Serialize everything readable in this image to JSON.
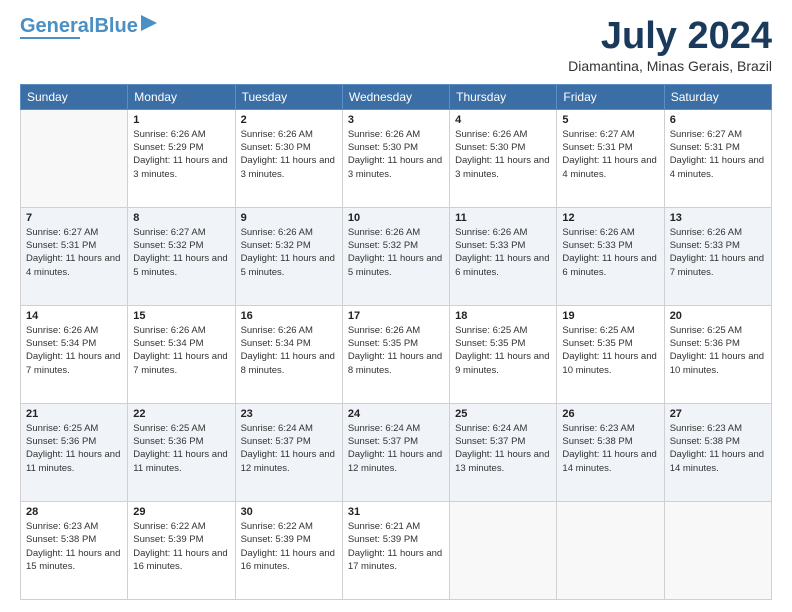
{
  "logo": {
    "part1": "General",
    "part2": "Blue"
  },
  "header": {
    "month": "July 2024",
    "location": "Diamantina, Minas Gerais, Brazil"
  },
  "weekdays": [
    "Sunday",
    "Monday",
    "Tuesday",
    "Wednesday",
    "Thursday",
    "Friday",
    "Saturday"
  ],
  "weeks": [
    [
      {
        "day": "",
        "empty": true
      },
      {
        "day": "1",
        "sunrise": "Sunrise: 6:26 AM",
        "sunset": "Sunset: 5:29 PM",
        "daylight": "Daylight: 11 hours and 3 minutes."
      },
      {
        "day": "2",
        "sunrise": "Sunrise: 6:26 AM",
        "sunset": "Sunset: 5:30 PM",
        "daylight": "Daylight: 11 hours and 3 minutes."
      },
      {
        "day": "3",
        "sunrise": "Sunrise: 6:26 AM",
        "sunset": "Sunset: 5:30 PM",
        "daylight": "Daylight: 11 hours and 3 minutes."
      },
      {
        "day": "4",
        "sunrise": "Sunrise: 6:26 AM",
        "sunset": "Sunset: 5:30 PM",
        "daylight": "Daylight: 11 hours and 3 minutes."
      },
      {
        "day": "5",
        "sunrise": "Sunrise: 6:27 AM",
        "sunset": "Sunset: 5:31 PM",
        "daylight": "Daylight: 11 hours and 4 minutes."
      },
      {
        "day": "6",
        "sunrise": "Sunrise: 6:27 AM",
        "sunset": "Sunset: 5:31 PM",
        "daylight": "Daylight: 11 hours and 4 minutes."
      }
    ],
    [
      {
        "day": "7",
        "sunrise": "Sunrise: 6:27 AM",
        "sunset": "Sunset: 5:31 PM",
        "daylight": "Daylight: 11 hours and 4 minutes."
      },
      {
        "day": "8",
        "sunrise": "Sunrise: 6:27 AM",
        "sunset": "Sunset: 5:32 PM",
        "daylight": "Daylight: 11 hours and 5 minutes."
      },
      {
        "day": "9",
        "sunrise": "Sunrise: 6:26 AM",
        "sunset": "Sunset: 5:32 PM",
        "daylight": "Daylight: 11 hours and 5 minutes."
      },
      {
        "day": "10",
        "sunrise": "Sunrise: 6:26 AM",
        "sunset": "Sunset: 5:32 PM",
        "daylight": "Daylight: 11 hours and 5 minutes."
      },
      {
        "day": "11",
        "sunrise": "Sunrise: 6:26 AM",
        "sunset": "Sunset: 5:33 PM",
        "daylight": "Daylight: 11 hours and 6 minutes."
      },
      {
        "day": "12",
        "sunrise": "Sunrise: 6:26 AM",
        "sunset": "Sunset: 5:33 PM",
        "daylight": "Daylight: 11 hours and 6 minutes."
      },
      {
        "day": "13",
        "sunrise": "Sunrise: 6:26 AM",
        "sunset": "Sunset: 5:33 PM",
        "daylight": "Daylight: 11 hours and 7 minutes."
      }
    ],
    [
      {
        "day": "14",
        "sunrise": "Sunrise: 6:26 AM",
        "sunset": "Sunset: 5:34 PM",
        "daylight": "Daylight: 11 hours and 7 minutes."
      },
      {
        "day": "15",
        "sunrise": "Sunrise: 6:26 AM",
        "sunset": "Sunset: 5:34 PM",
        "daylight": "Daylight: 11 hours and 7 minutes."
      },
      {
        "day": "16",
        "sunrise": "Sunrise: 6:26 AM",
        "sunset": "Sunset: 5:34 PM",
        "daylight": "Daylight: 11 hours and 8 minutes."
      },
      {
        "day": "17",
        "sunrise": "Sunrise: 6:26 AM",
        "sunset": "Sunset: 5:35 PM",
        "daylight": "Daylight: 11 hours and 8 minutes."
      },
      {
        "day": "18",
        "sunrise": "Sunrise: 6:25 AM",
        "sunset": "Sunset: 5:35 PM",
        "daylight": "Daylight: 11 hours and 9 minutes."
      },
      {
        "day": "19",
        "sunrise": "Sunrise: 6:25 AM",
        "sunset": "Sunset: 5:35 PM",
        "daylight": "Daylight: 11 hours and 10 minutes."
      },
      {
        "day": "20",
        "sunrise": "Sunrise: 6:25 AM",
        "sunset": "Sunset: 5:36 PM",
        "daylight": "Daylight: 11 hours and 10 minutes."
      }
    ],
    [
      {
        "day": "21",
        "sunrise": "Sunrise: 6:25 AM",
        "sunset": "Sunset: 5:36 PM",
        "daylight": "Daylight: 11 hours and 11 minutes."
      },
      {
        "day": "22",
        "sunrise": "Sunrise: 6:25 AM",
        "sunset": "Sunset: 5:36 PM",
        "daylight": "Daylight: 11 hours and 11 minutes."
      },
      {
        "day": "23",
        "sunrise": "Sunrise: 6:24 AM",
        "sunset": "Sunset: 5:37 PM",
        "daylight": "Daylight: 11 hours and 12 minutes."
      },
      {
        "day": "24",
        "sunrise": "Sunrise: 6:24 AM",
        "sunset": "Sunset: 5:37 PM",
        "daylight": "Daylight: 11 hours and 12 minutes."
      },
      {
        "day": "25",
        "sunrise": "Sunrise: 6:24 AM",
        "sunset": "Sunset: 5:37 PM",
        "daylight": "Daylight: 11 hours and 13 minutes."
      },
      {
        "day": "26",
        "sunrise": "Sunrise: 6:23 AM",
        "sunset": "Sunset: 5:38 PM",
        "daylight": "Daylight: 11 hours and 14 minutes."
      },
      {
        "day": "27",
        "sunrise": "Sunrise: 6:23 AM",
        "sunset": "Sunset: 5:38 PM",
        "daylight": "Daylight: 11 hours and 14 minutes."
      }
    ],
    [
      {
        "day": "28",
        "sunrise": "Sunrise: 6:23 AM",
        "sunset": "Sunset: 5:38 PM",
        "daylight": "Daylight: 11 hours and 15 minutes."
      },
      {
        "day": "29",
        "sunrise": "Sunrise: 6:22 AM",
        "sunset": "Sunset: 5:39 PM",
        "daylight": "Daylight: 11 hours and 16 minutes."
      },
      {
        "day": "30",
        "sunrise": "Sunrise: 6:22 AM",
        "sunset": "Sunset: 5:39 PM",
        "daylight": "Daylight: 11 hours and 16 minutes."
      },
      {
        "day": "31",
        "sunrise": "Sunrise: 6:21 AM",
        "sunset": "Sunset: 5:39 PM",
        "daylight": "Daylight: 11 hours and 17 minutes."
      },
      {
        "day": "",
        "empty": true
      },
      {
        "day": "",
        "empty": true
      },
      {
        "day": "",
        "empty": true
      }
    ]
  ]
}
